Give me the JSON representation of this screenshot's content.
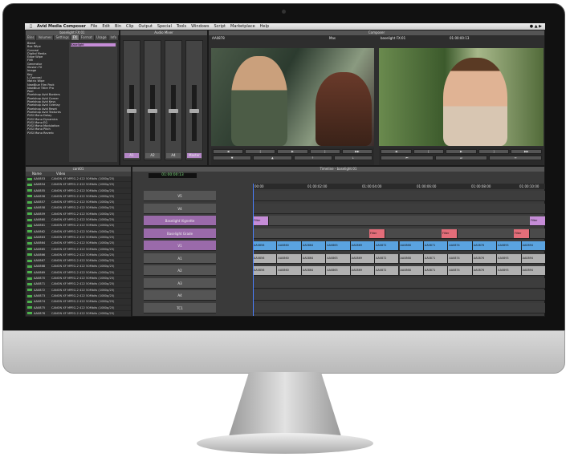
{
  "menubar": {
    "app_name": "Avid Media Composer",
    "items": [
      "File",
      "Edit",
      "Bin",
      "Clip",
      "Output",
      "Special",
      "Tools",
      "Windows",
      "Script",
      "Marketplace",
      "Help"
    ]
  },
  "effect_palette": {
    "title": "baselight FX:01",
    "tabs": [
      "Bins",
      "Volumes",
      "Settings",
      "FX",
      "Format",
      "Usage",
      "Info"
    ],
    "active_tab": "FX",
    "selected_effect": "Baselight",
    "effects": [
      "Blend",
      "Box Wipe",
      "Conceal",
      "Digital Media",
      "Edge Wipe",
      "Film",
      "Generator",
      "Illusion FX",
      "Image",
      "Key",
      "L-Conceal",
      "Matrix Wipe",
      "NewBlue Film Pack",
      "NewBlue Titler Pro",
      "Peel",
      "Pixelshop Avid Borders",
      "Pixelshop Avid Corner",
      "Pixelshop Avid Keys",
      "Pixelshop Avid Overlay",
      "Pixelshop Avid Reset",
      "Pixelshop Avid Textures",
      "PXSI Mono Delay",
      "PXSI Mono Dynamics",
      "PXSI Mono EQ",
      "PXSI Mono Modulation",
      "PXSI Mono Pitch",
      "PXSI Mono Reverb"
    ]
  },
  "audio_mixer": {
    "title": "Audio Mixer",
    "channels": [
      {
        "label": "A1",
        "level": 0.45,
        "selected": true
      },
      {
        "label": "A2",
        "level": 0.45,
        "selected": false
      },
      {
        "label": "A4",
        "level": 0.45,
        "selected": false
      },
      {
        "label": "Master",
        "level": 0.45,
        "selected": true
      }
    ]
  },
  "composer": {
    "title": "Composer",
    "source_clip": "AA0878",
    "record_info": "baselight FX:01",
    "source_tc": "Mas",
    "record_tc": "01:00:00:13"
  },
  "bin": {
    "title": "card01",
    "columns": [
      "Name",
      "Video"
    ],
    "rows": [
      {
        "name": "AA0853",
        "video": "CANON XF MPEG-2 422 50Mbits (1080p/25)"
      },
      {
        "name": "AA0854",
        "video": "CANON XF MPEG-2 422 50Mbits (1080p/25)"
      },
      {
        "name": "AA0855",
        "video": "CANON XF MPEG-2 422 50Mbits (1080p/25)"
      },
      {
        "name": "AA0856",
        "video": "CANON XF MPEG-2 422 50Mbits (1080p/25)"
      },
      {
        "name": "AA0857",
        "video": "CANON XF MPEG-2 422 50Mbits (1080p/25)"
      },
      {
        "name": "AA0858",
        "video": "CANON XF MPEG-2 422 50Mbits (1080p/25)"
      },
      {
        "name": "AA0859",
        "video": "CANON XF MPEG-2 422 50Mbits (1080p/25)"
      },
      {
        "name": "AA0860",
        "video": "CANON XF MPEG-2 422 50Mbits (1080p/25)"
      },
      {
        "name": "AA0861",
        "video": "CANON XF MPEG-2 422 50Mbits (1080p/25)"
      },
      {
        "name": "AA0862",
        "video": "CANON XF MPEG-2 422 50Mbits (1080p/25)"
      },
      {
        "name": "AA0863",
        "video": "CANON XF MPEG-2 422 50Mbits (1080p/25)"
      },
      {
        "name": "AA0864",
        "video": "CANON XF MPEG-2 422 50Mbits (1080p/25)"
      },
      {
        "name": "AA0865",
        "video": "CANON XF MPEG-2 422 50Mbits (1080p/25)"
      },
      {
        "name": "AA0866",
        "video": "CANON XF MPEG-2 422 50Mbits (1080p/25)"
      },
      {
        "name": "AA0867",
        "video": "CANON XF MPEG-2 422 50Mbits (1080p/25)"
      },
      {
        "name": "AA0868",
        "video": "CANON XF MPEG-2 422 50Mbits (1080p/25)"
      },
      {
        "name": "AA0869",
        "video": "CANON XF MPEG-2 422 50Mbits (1080p/25)"
      },
      {
        "name": "AA0870",
        "video": "CANON XF MPEG-2 422 50Mbits (1080p/25)"
      },
      {
        "name": "AA0871",
        "video": "CANON XF MPEG-2 422 50Mbits (1080p/25)"
      },
      {
        "name": "AA0872",
        "video": "CANON XF MPEG-2 422 50Mbits (1080p/25)"
      },
      {
        "name": "AA0873",
        "video": "CANON XF MPEG-2 422 50Mbits (1080p/25)"
      },
      {
        "name": "AA0874",
        "video": "CANON XF MPEG-2 422 50Mbits (1080p/25)"
      },
      {
        "name": "AA0875",
        "video": "CANON XF MPEG-2 422 50Mbits (1080p/25)"
      },
      {
        "name": "AA0876",
        "video": "CANON XF MPEG-2 422 50Mbits (1080p/25)"
      },
      {
        "name": "AA0877",
        "video": "CANON XF MPEG-2 422 50Mbits (1080p/25)"
      },
      {
        "name": "AA0878",
        "video": "CANON XF MPEG-2 422 50Mbits (1080p/25)",
        "selected": true
      },
      {
        "name": "AA0879",
        "video": "CANON XF MPEG-2 422 50Mbits (1080p/25)"
      },
      {
        "name": "AA0880",
        "video": "CANON XF MPEG-2 422 50Mbits (1080p/25)"
      },
      {
        "name": "AA0881",
        "video": "CANON XF MPEG-2 422 50Mbits (1080p/25)"
      },
      {
        "name": "AA0882",
        "video": "CANON XF MPEG-2 422 50Mbits (1080p/25)"
      },
      {
        "name": "AA0883",
        "video": "CANON XF MPEG-2 422 50Mbits (1080p/25)"
      },
      {
        "name": "AA0884",
        "video": "CANON XF MPEG-2 422 50Mbits (1080p/25)"
      }
    ]
  },
  "timeline": {
    "title": "Timeline - baselight:01",
    "timecode": "01:00:00:13",
    "ruler": [
      "00:00",
      "01:00:02:00",
      "01:00:04:00",
      "01:00:06:00",
      "01:00:08:00",
      "01:00:10:00"
    ],
    "tracks": [
      {
        "label": "V5"
      },
      {
        "label": "V4"
      },
      {
        "label": "Baselight Vignette"
      },
      {
        "label": "Baselight Grade"
      },
      {
        "label": "V1",
        "clips": [
          "AA0856",
          "AA0860",
          "AA0864",
          "AA0865",
          "AA0869",
          "AA0872",
          "AA0868",
          "AA0871",
          "AA0874",
          "AA0876",
          "AA0893",
          "AA0894"
        ]
      },
      {
        "label": "A1",
        "clips": [
          "AA0856",
          "AA0860",
          "AA0864",
          "AA0865",
          "AA0869",
          "AA0872",
          "AA0868",
          "AA0871",
          "AA0874",
          "AA0876",
          "AA0893",
          "AA0894"
        ]
      },
      {
        "label": "A2",
        "clips": [
          "AA0856",
          "AA0860",
          "AA0864",
          "AA0865",
          "AA0869",
          "AA0872",
          "AA0868",
          "AA0871",
          "AA0874",
          "AA0876",
          "AA0893",
          "AA0894"
        ]
      },
      {
        "label": "A3"
      },
      {
        "label": "A4"
      },
      {
        "label": "TC1"
      }
    ],
    "filter_label": "Filter"
  }
}
